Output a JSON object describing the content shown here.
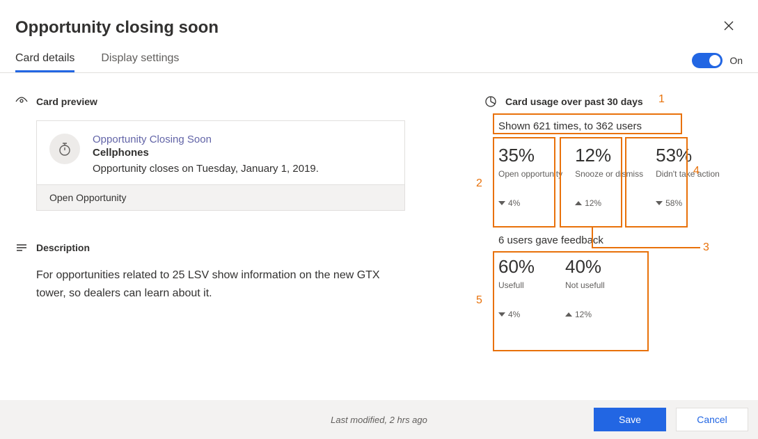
{
  "title": "Opportunity closing soon",
  "tabs": {
    "card_details": "Card details",
    "display_settings": "Display settings"
  },
  "toggle": {
    "label": "On",
    "state": true
  },
  "left": {
    "preview_heading": "Card preview",
    "preview": {
      "title": "Opportunity Closing Soon",
      "subtitle": "Cellphones",
      "body": "Opportunity closes on Tuesday, January 1, 2019.",
      "action": "Open Opportunity"
    },
    "description_heading": "Description",
    "description_body": "For opportunities related to 25 LSV show information on the new GTX tower, so dealers can learn about it."
  },
  "usage": {
    "heading": "Card usage over past 30 days",
    "summary": "Shown 621 times, to 362 users",
    "stats": [
      {
        "pct": "35%",
        "label": "Open opportunity",
        "delta_dir": "down",
        "delta": "4%"
      },
      {
        "pct": "12%",
        "label": "Snooze or dismiss",
        "delta_dir": "up",
        "delta": "12%"
      },
      {
        "pct": "53%",
        "label": "Didn't take action",
        "delta_dir": "down",
        "delta": "58%"
      }
    ],
    "feedback_title": "6 users gave feedback",
    "feedback": [
      {
        "pct": "60%",
        "label": "Usefull",
        "delta_dir": "down",
        "delta": "4%"
      },
      {
        "pct": "40%",
        "label": "Not usefull",
        "delta_dir": "up",
        "delta": "12%"
      }
    ]
  },
  "annotations": {
    "1": "1",
    "2": "2",
    "3": "3",
    "4": "4",
    "5": "5"
  },
  "footer": {
    "modified": "Last modified, 2 hrs ago",
    "save": "Save",
    "cancel": "Cancel"
  }
}
